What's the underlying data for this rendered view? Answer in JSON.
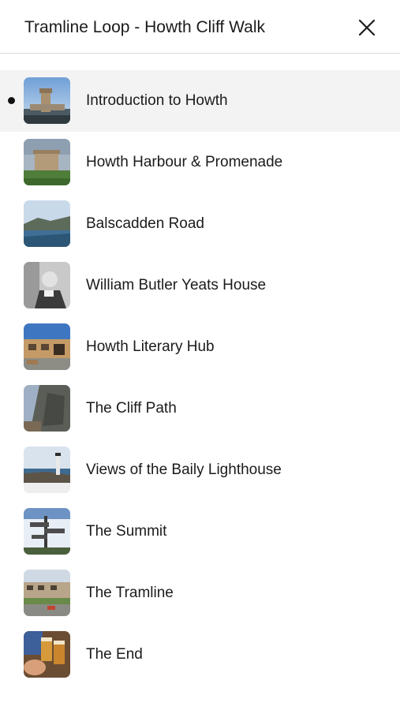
{
  "header": {
    "title": "Tramline Loop - Howth Cliff Walk",
    "close_icon": "close-icon"
  },
  "stops": [
    {
      "label": "Introduction to Howth",
      "active": true,
      "thumb": "tower-photo"
    },
    {
      "label": "Howth Harbour & Promenade",
      "active": false,
      "thumb": "martello-tower-photo"
    },
    {
      "label": "Balscadden Road",
      "active": false,
      "thumb": "coast-photo"
    },
    {
      "label": "William Butler Yeats House",
      "active": false,
      "thumb": "yeats-portrait-photo"
    },
    {
      "label": "Howth Literary Hub",
      "active": false,
      "thumb": "building-photo"
    },
    {
      "label": "The Cliff Path",
      "active": false,
      "thumb": "cliff-photo"
    },
    {
      "label": "Views of the Baily Lighthouse",
      "active": false,
      "thumb": "lighthouse-photo"
    },
    {
      "label": "The Summit",
      "active": false,
      "thumb": "signpost-photo"
    },
    {
      "label": "The Tramline",
      "active": false,
      "thumb": "village-photo"
    },
    {
      "label": "The End",
      "active": false,
      "thumb": "pints-photo"
    }
  ],
  "colors": {
    "active_row_bg": "#f3f3f3",
    "divider": "#d9d9d9",
    "text": "#1b1b1b"
  }
}
